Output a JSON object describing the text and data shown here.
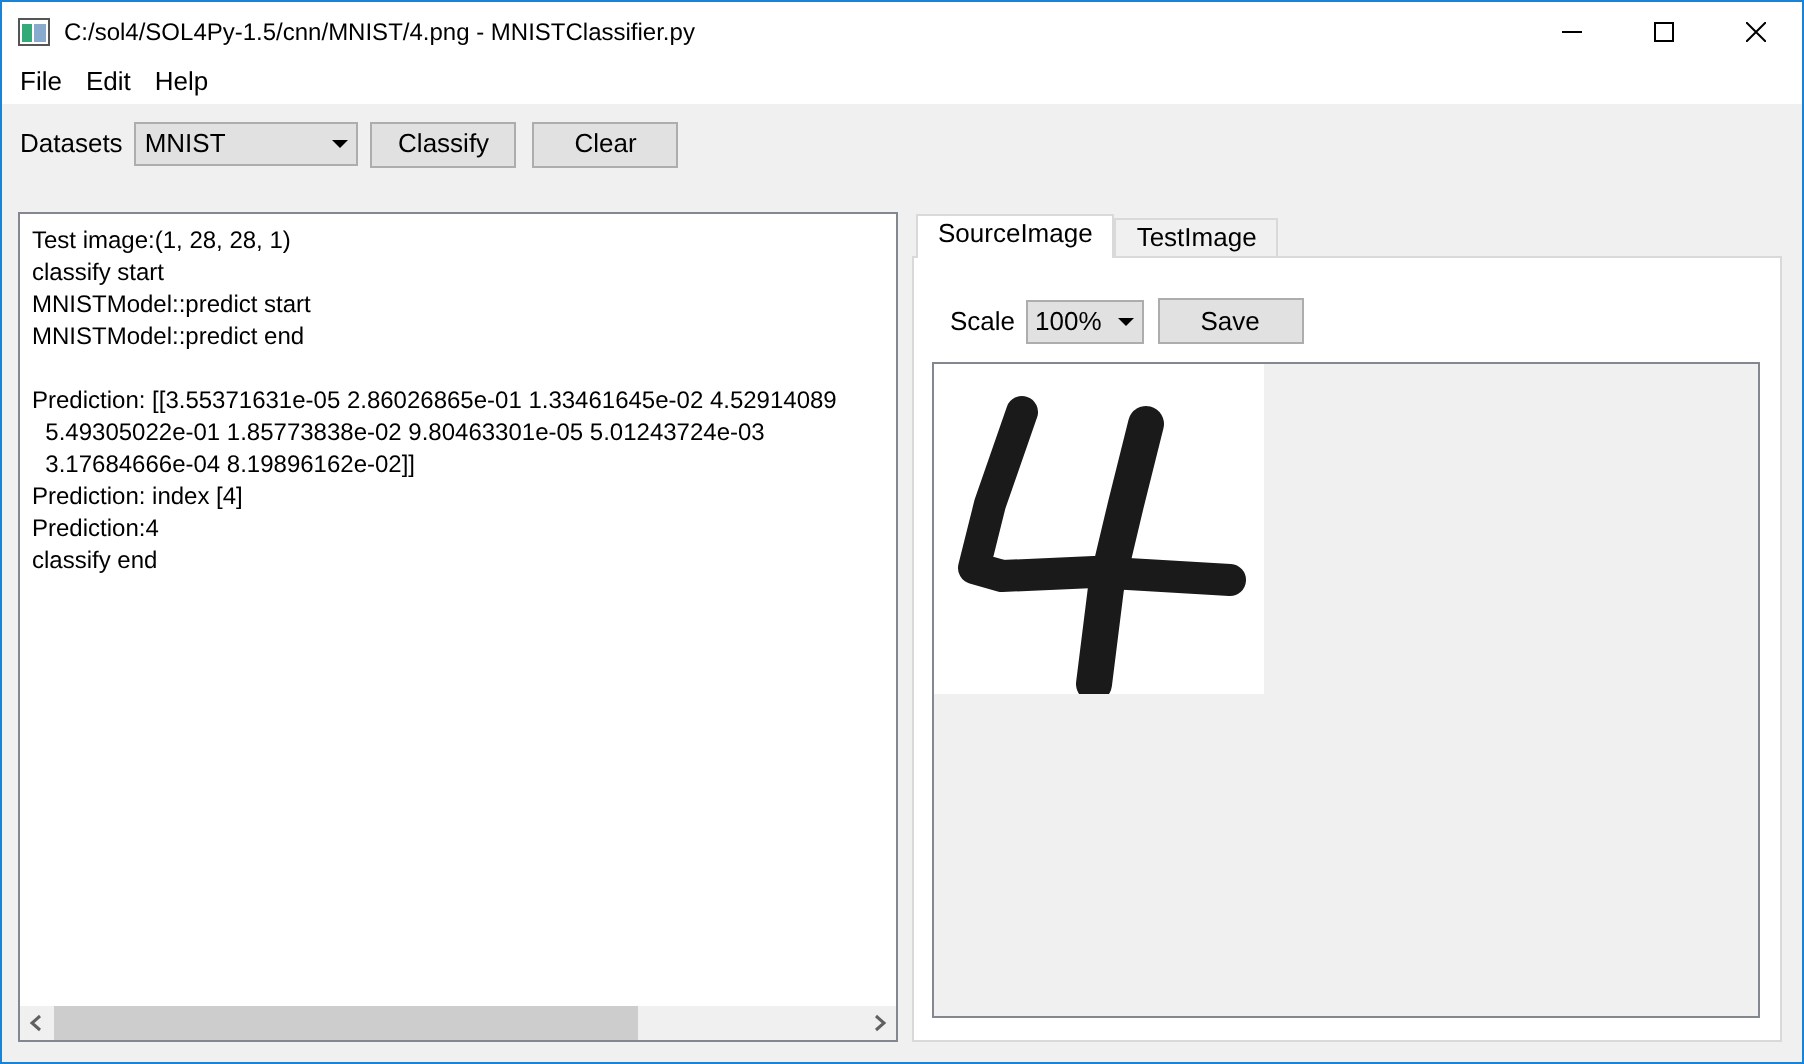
{
  "window": {
    "title": "C:/sol4/SOL4Py-1.5/cnn/MNIST/4.png - MNISTClassifier.py"
  },
  "menu": [
    {
      "label": "File"
    },
    {
      "label": "Edit"
    },
    {
      "label": "Help"
    }
  ],
  "toolbar": {
    "datasets_label": "Datasets",
    "datasets_value": "MNIST",
    "buttons": [
      "Classify",
      "Clear"
    ]
  },
  "log_blocks": [
    {
      "lines": [
        "Test image:(1, 28, 28, 1)",
        "classify start",
        "MNISTModel::predict start",
        "MNISTModel::predict end"
      ]
    },
    {
      "lines": [
        "Prediction: [[3.55371631e-05 2.86026865e-01 1.33461645e-02 4.52914089",
        "  5.49305022e-01 1.85773838e-02 9.80463301e-05 5.01243724e-03",
        "  3.17684666e-04 8.19896162e-02]]",
        "Prediction: index [4]",
        "Prediction:4",
        "classify end"
      ]
    }
  ],
  "tabs": [
    {
      "label": "SourceImage",
      "selected": true
    },
    {
      "label": "TestImage",
      "selected": false
    }
  ],
  "image_pane": {
    "scale_label": "Scale",
    "scale_value": "100%",
    "save_button": "Save"
  }
}
